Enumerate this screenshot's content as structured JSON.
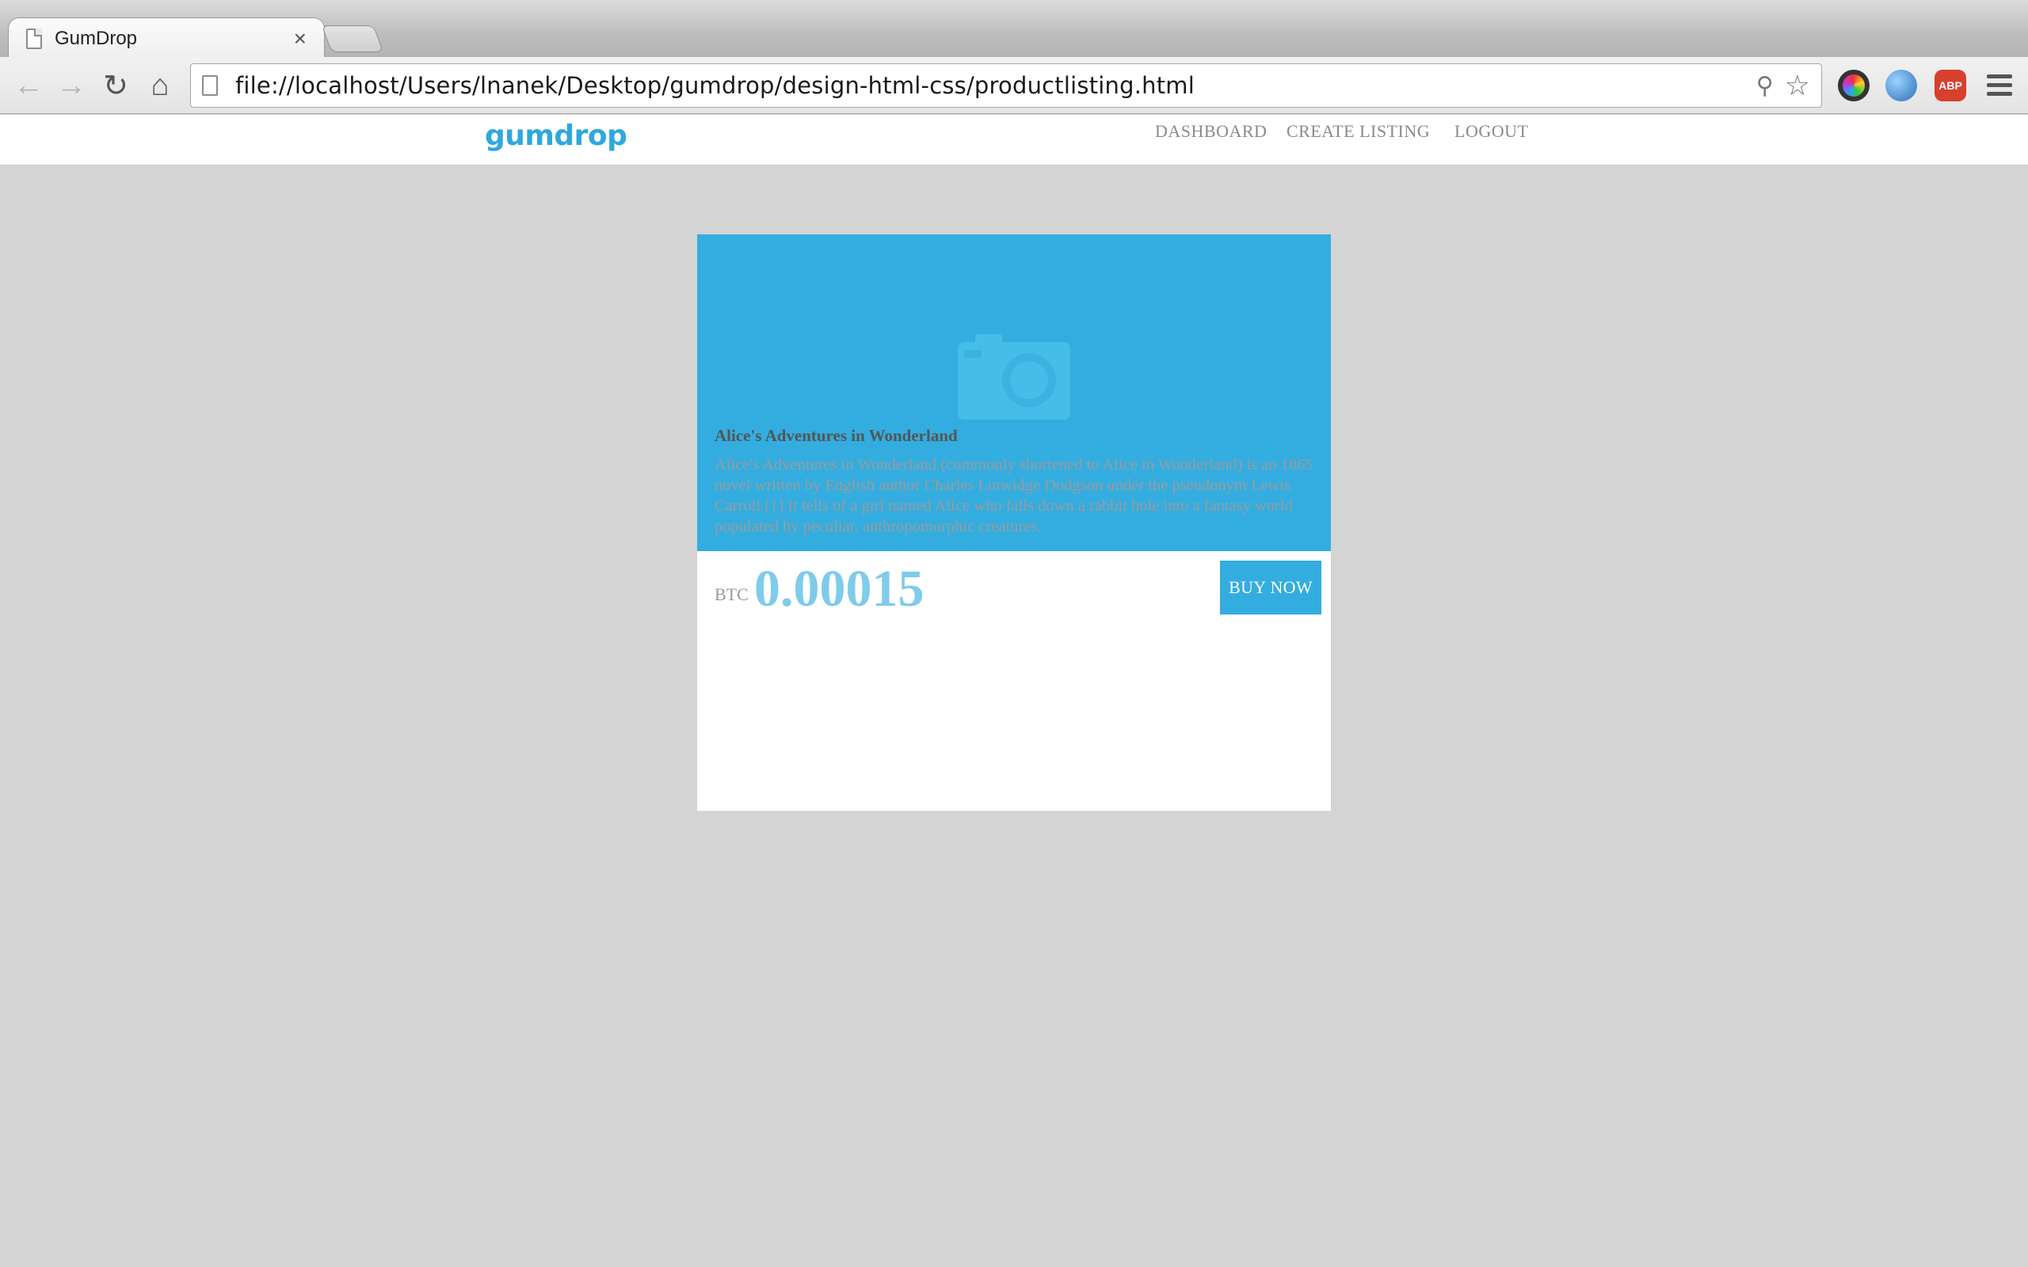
{
  "browser": {
    "tab_title": "GumDrop",
    "tab_close": "×",
    "url": "file://localhost/Users/lnanek/Desktop/gumdrop/design-html-css/productlisting.html",
    "back_icon": "←",
    "forward_icon": "→",
    "reload_icon": "↻",
    "home_icon": "⌂",
    "zoom_icon": "⚲",
    "star_icon": "☆",
    "extensions": [
      "color-picker-icon",
      "globe-icon",
      "adblock-icon"
    ],
    "abp_label": "ABP"
  },
  "site": {
    "logo": "gumdrop",
    "nav": [
      "DASHBOARD",
      "CREATE LISTING",
      "LOGOUT"
    ]
  },
  "listing": {
    "currency": "BTC",
    "price": "0.00015",
    "buy_label": "BUY NOW",
    "title": "Alice's Adventures in Wonderland",
    "description": "Alice's Adventures in Wonderland (commonly shortened to Alice in Wonderland) is an 1865 novel written by English author Charles Lutwidge Dodgson under the pseudonym Lewis Carroll.[1] It tells of a girl named Alice who falls down a rabbit hole into a fantasy world populated by peculiar, anthropomorphic creatures."
  },
  "colors": {
    "accent": "#33ade0",
    "price": "#7fcbea",
    "background": "#d4d4d4"
  }
}
